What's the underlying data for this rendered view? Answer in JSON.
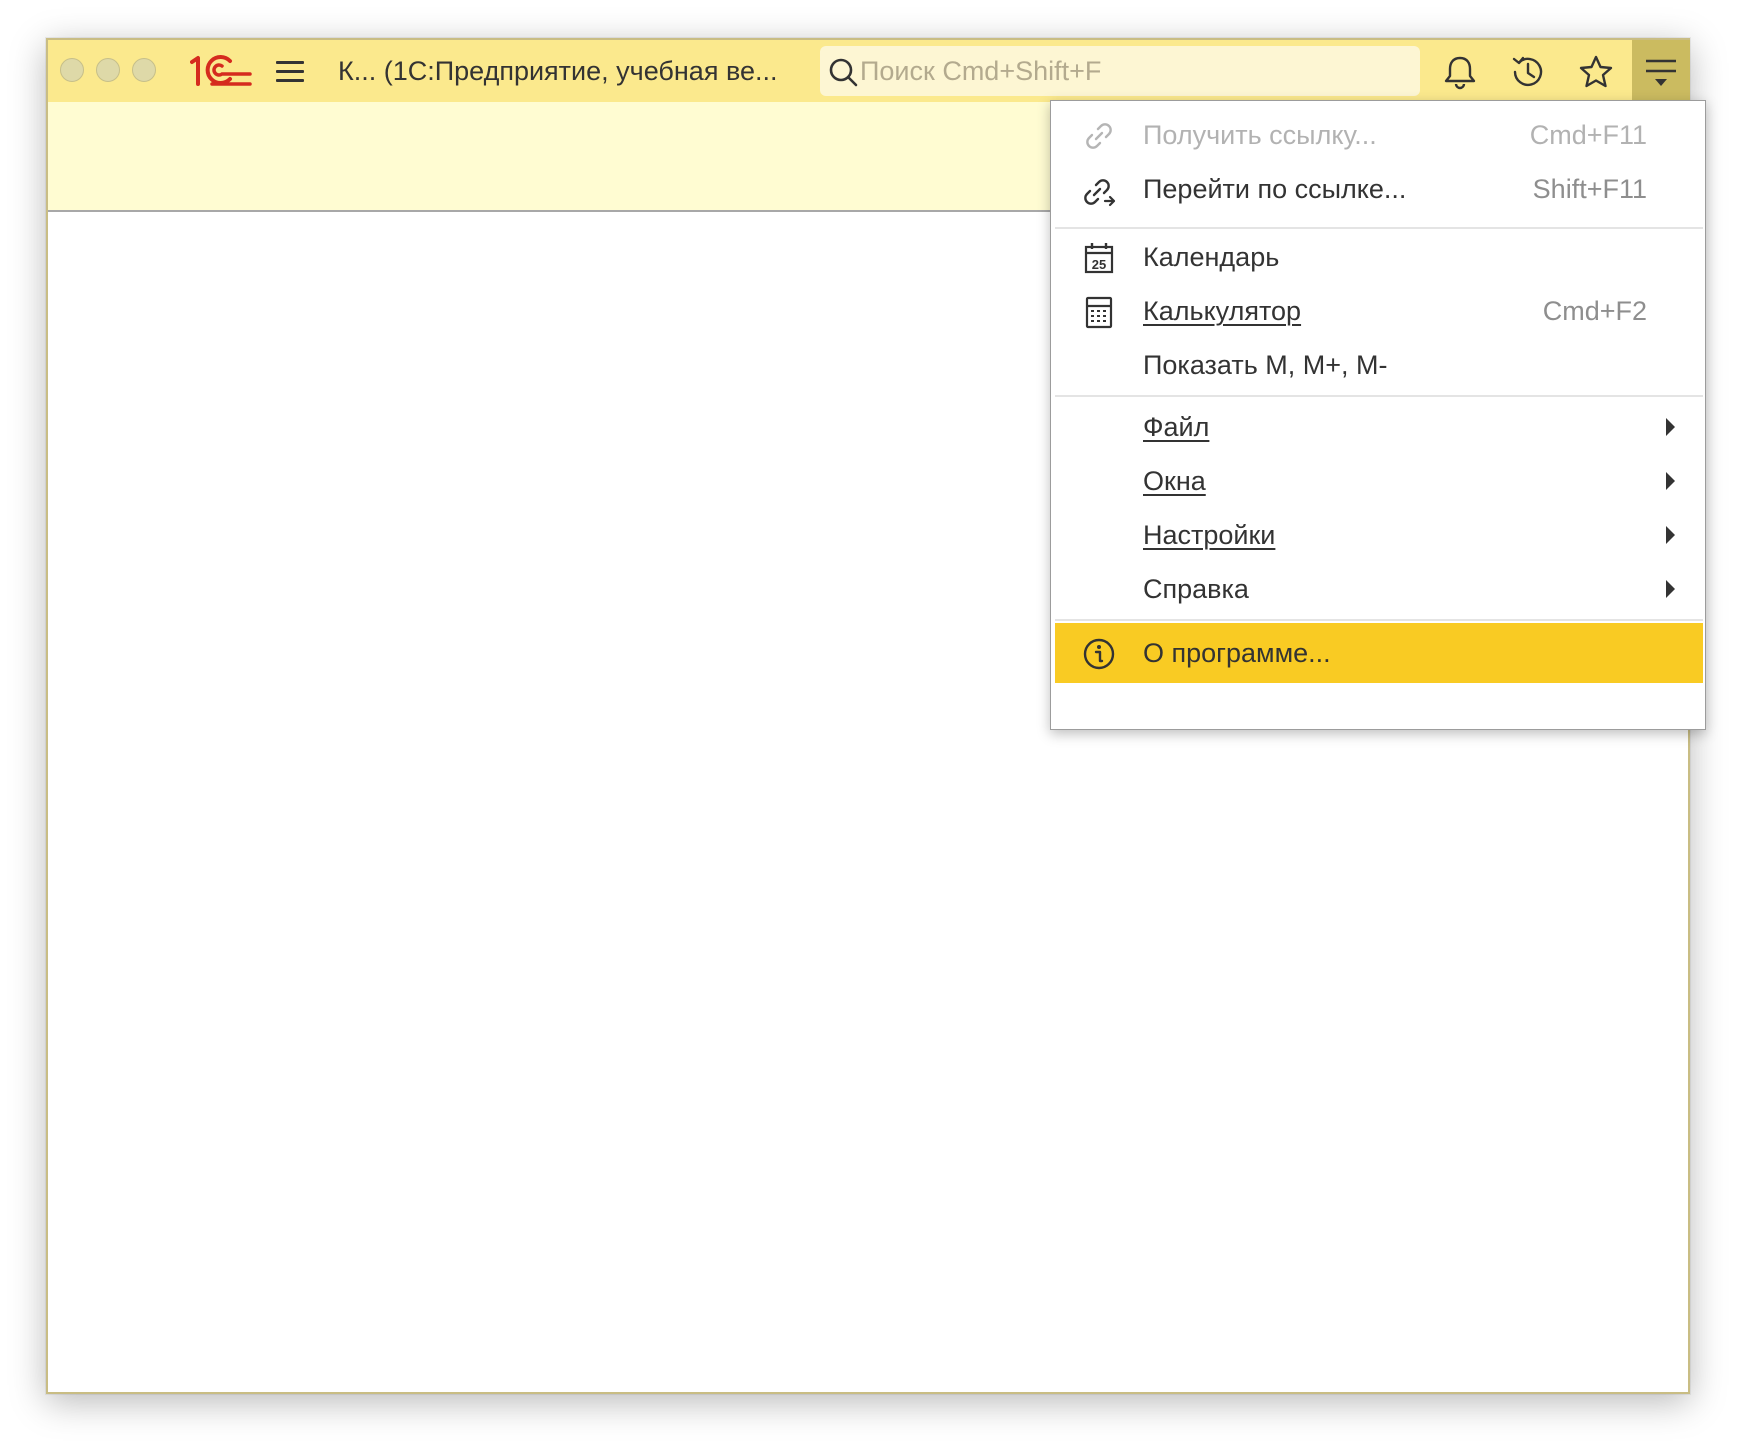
{
  "window": {
    "title": "К...  (1С:Предприятие, учебная ве...",
    "brand": "1С"
  },
  "search": {
    "placeholder": "Поиск Cmd+Shift+F",
    "value": ""
  },
  "toolbar": {
    "icons": [
      "bell-icon",
      "history-icon",
      "star-icon",
      "menu-icon"
    ]
  },
  "menu": {
    "items": [
      {
        "label": "Получить ссылку...",
        "shortcut": "Cmd+F11",
        "icon": "link-icon",
        "disabled": true
      },
      {
        "label": "Перейти по ссылке...",
        "shortcut": "Shift+F11",
        "icon": "go-to-link-icon"
      },
      {
        "label": "Календарь",
        "icon": "calendar-icon",
        "icon_text": "25"
      },
      {
        "label": "Калькулятор",
        "shortcut": "Cmd+F2",
        "icon": "calculator-icon"
      },
      {
        "label": "Показать M, M+, M-"
      },
      {
        "label": "Файл",
        "submenu": true
      },
      {
        "label": "Окна",
        "submenu": true
      },
      {
        "label": "Настройки",
        "submenu": true
      },
      {
        "label": "Справка",
        "submenu": true
      },
      {
        "label": "О программе...",
        "icon": "info-icon",
        "highlighted": true
      }
    ]
  },
  "colors": {
    "titlebar": "#fbe98d",
    "infobar": "#fffcd2",
    "highlight": "#f9cb23",
    "brand_red": "#d52b1e"
  }
}
